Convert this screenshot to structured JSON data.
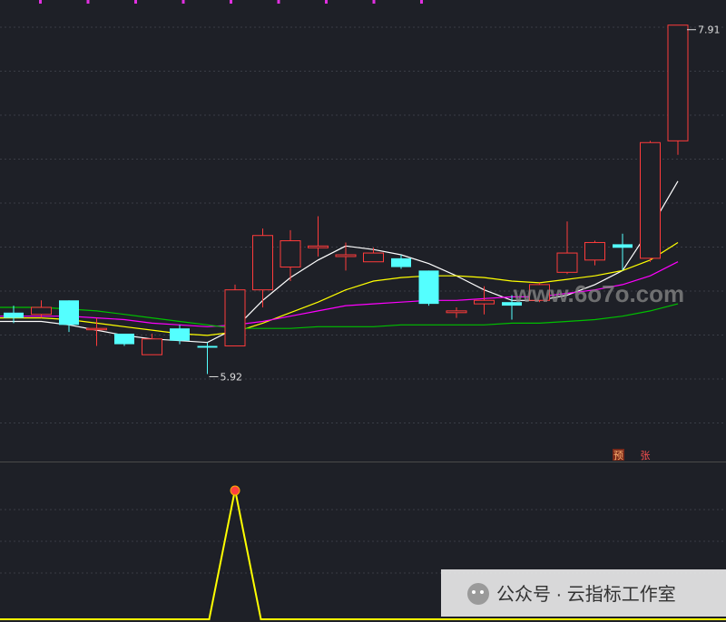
{
  "chart_data": [
    {
      "type": "candlestick",
      "ylim": [
        5.55,
        7.95
      ],
      "grid": true,
      "annotations": {
        "high": "7.91",
        "low": "5.92"
      },
      "candles": [
        {
          "o": 6.27,
          "h": 6.31,
          "l": 6.21,
          "c": 6.24
        },
        {
          "o": 6.26,
          "h": 6.34,
          "l": 6.24,
          "c": 6.3
        },
        {
          "o": 6.34,
          "h": 6.34,
          "l": 6.16,
          "c": 6.2
        },
        {
          "o": 6.18,
          "h": 6.24,
          "l": 6.08,
          "c": 6.18
        },
        {
          "o": 6.15,
          "h": 6.15,
          "l": 6.08,
          "c": 6.09
        },
        {
          "o": 6.03,
          "h": 6.15,
          "l": 6.03,
          "c": 6.12
        },
        {
          "o": 6.18,
          "h": 6.2,
          "l": 6.09,
          "c": 6.11
        },
        {
          "o": 6.08,
          "h": 6.1,
          "l": 5.92,
          "c": 6.07
        },
        {
          "o": 6.08,
          "h": 6.43,
          "l": 6.08,
          "c": 6.4
        },
        {
          "o": 6.4,
          "h": 6.75,
          "l": 6.3,
          "c": 6.71
        },
        {
          "o": 6.53,
          "h": 6.74,
          "l": 6.45,
          "c": 6.68
        },
        {
          "o": 6.64,
          "h": 6.82,
          "l": 6.59,
          "c": 6.65
        },
        {
          "o": 6.59,
          "h": 6.67,
          "l": 6.51,
          "c": 6.6
        },
        {
          "o": 6.56,
          "h": 6.64,
          "l": 6.56,
          "c": 6.61
        },
        {
          "o": 6.58,
          "h": 6.6,
          "l": 6.52,
          "c": 6.53
        },
        {
          "o": 6.51,
          "h": 6.51,
          "l": 6.31,
          "c": 6.32
        },
        {
          "o": 6.27,
          "h": 6.3,
          "l": 6.24,
          "c": 6.28
        },
        {
          "o": 6.32,
          "h": 6.42,
          "l": 6.26,
          "c": 6.34
        },
        {
          "o": 6.33,
          "h": 6.37,
          "l": 6.23,
          "c": 6.31
        },
        {
          "o": 6.34,
          "h": 6.44,
          "l": 6.33,
          "c": 6.43
        },
        {
          "o": 6.5,
          "h": 6.79,
          "l": 6.49,
          "c": 6.61
        },
        {
          "o": 6.57,
          "h": 6.68,
          "l": 6.54,
          "c": 6.67
        },
        {
          "o": 6.66,
          "h": 6.72,
          "l": 6.51,
          "c": 6.64
        },
        {
          "o": 6.58,
          "h": 7.25,
          "l": 6.56,
          "c": 7.24
        },
        {
          "o": 7.25,
          "h": 7.91,
          "l": 7.17,
          "c": 7.91
        }
      ],
      "series": [
        {
          "color": "#ffffff",
          "values": [
            6.22,
            6.22,
            6.2,
            6.17,
            6.14,
            6.12,
            6.11,
            6.1,
            6.18,
            6.34,
            6.47,
            6.57,
            6.65,
            6.63,
            6.6,
            6.55,
            6.48,
            6.4,
            6.34,
            6.34,
            6.37,
            6.43,
            6.51,
            6.75,
            7.02
          ]
        },
        {
          "color": "#ffff00",
          "values": [
            6.24,
            6.24,
            6.23,
            6.21,
            6.19,
            6.17,
            6.15,
            6.14,
            6.16,
            6.21,
            6.27,
            6.33,
            6.4,
            6.45,
            6.47,
            6.48,
            6.48,
            6.47,
            6.45,
            6.44,
            6.46,
            6.48,
            6.51,
            6.57,
            6.67
          ]
        },
        {
          "color": "#ff00ff",
          "values": [
            6.25,
            6.25,
            6.25,
            6.24,
            6.23,
            6.21,
            6.2,
            6.19,
            6.2,
            6.22,
            6.25,
            6.28,
            6.31,
            6.32,
            6.33,
            6.34,
            6.34,
            6.35,
            6.36,
            6.36,
            6.38,
            6.4,
            6.43,
            6.48,
            6.56
          ]
        },
        {
          "color": "#00c000",
          "values": [
            6.3,
            6.3,
            6.29,
            6.28,
            6.26,
            6.24,
            6.22,
            6.2,
            6.18,
            6.18,
            6.18,
            6.19,
            6.19,
            6.19,
            6.2,
            6.2,
            6.2,
            6.2,
            6.21,
            6.21,
            6.22,
            6.23,
            6.25,
            6.28,
            6.32
          ]
        }
      ],
      "labels": {
        "yu": "预",
        "zhang": "张"
      },
      "top_ticks": 9
    },
    {
      "type": "line",
      "color": "#ffff00",
      "ylim": [
        0,
        1
      ],
      "values": [
        0,
        0,
        0,
        0,
        0,
        0,
        0,
        0,
        1,
        0,
        0,
        0,
        0,
        0,
        0,
        0,
        0,
        0,
        0,
        0,
        0,
        0,
        0,
        0,
        0
      ]
    }
  ],
  "watermark": {
    "site": "www.6o7o.com",
    "account": "公众号 · 云指标工作室"
  }
}
